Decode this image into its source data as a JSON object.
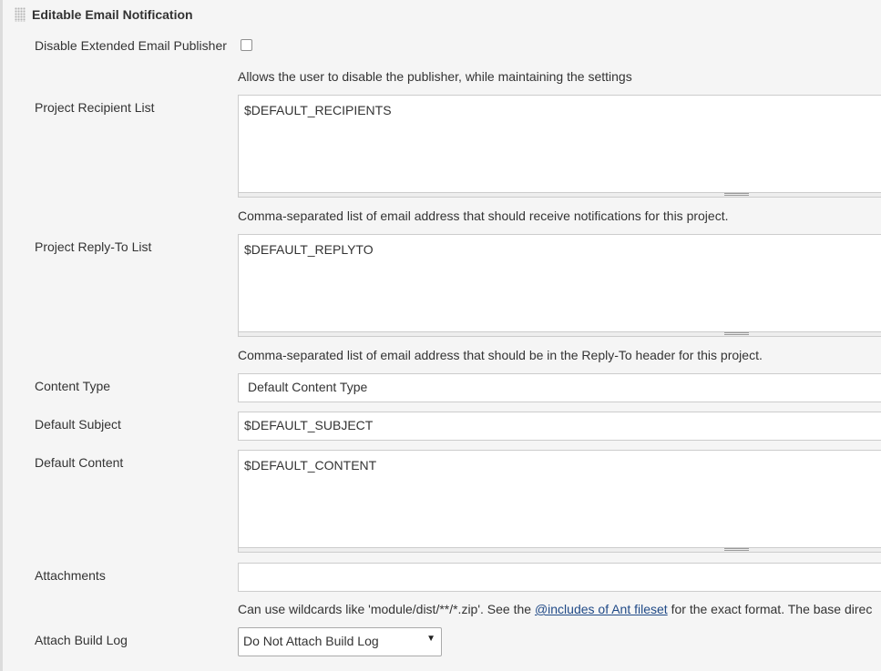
{
  "section": {
    "title": "Editable Email Notification"
  },
  "disable_publisher": {
    "label": "Disable Extended Email Publisher",
    "checked": false,
    "help": "Allows the user to disable the publisher, while maintaining the settings"
  },
  "recipient_list": {
    "label": "Project Recipient List",
    "value": "$DEFAULT_RECIPIENTS",
    "help": "Comma-separated list of email address that should receive notifications for this project."
  },
  "reply_to_list": {
    "label": "Project Reply-To List",
    "value": "$DEFAULT_REPLYTO",
    "help": "Comma-separated list of email address that should be in the Reply-To header for this project."
  },
  "content_type": {
    "label": "Content Type",
    "value": "Default Content Type"
  },
  "default_subject": {
    "label": "Default Subject",
    "value": "$DEFAULT_SUBJECT"
  },
  "default_content": {
    "label": "Default Content",
    "value": "$DEFAULT_CONTENT"
  },
  "attachments": {
    "label": "Attachments",
    "value": "",
    "help_before": "Can use wildcards like 'module/dist/**/*.zip'. See the ",
    "help_link": "@includes of Ant fileset",
    "help_after": " for the exact format. The base direc"
  },
  "attach_build_log": {
    "label": "Attach Build Log",
    "value": "Do Not Attach Build Log",
    "arrow": "▼"
  }
}
